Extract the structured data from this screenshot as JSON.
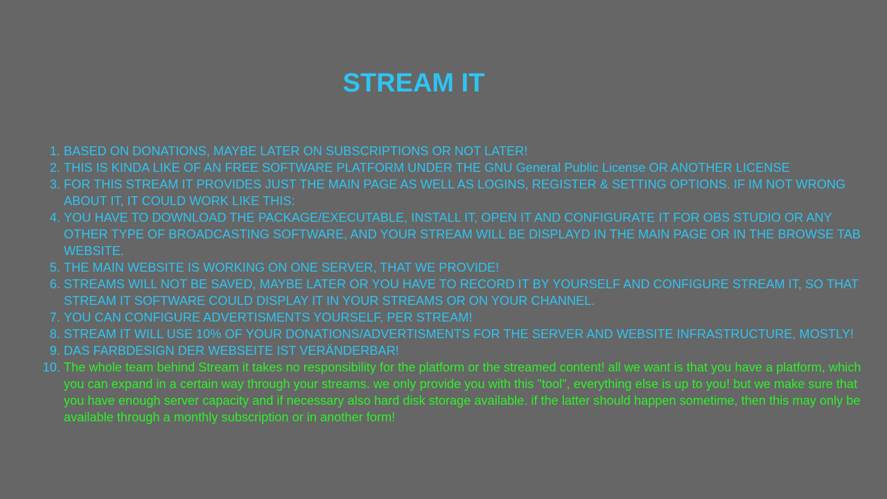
{
  "page": {
    "title": "STREAM IT",
    "colors": {
      "background": "#666666",
      "accent": "#2ec4f2",
      "highlight": "#2ef029"
    }
  },
  "list": {
    "items": [
      "BASED ON DONATIONS, MAYBE LATER ON SUBSCRIPTIONS OR NOT LATER!",
      "THIS IS KINDA LIKE OF AN FREE SOFTWARE PLATFORM UNDER THE GNU General Public License OR ANOTHER LICENSE",
      "FOR THIS STREAM IT PROVIDES JUST THE MAIN PAGE AS WELL AS LOGINS, REGISTER & SETTING OPTIONS. IF IM NOT WRONG ABOUT IT, IT COULD WORK LIKE THIS:",
      "YOU HAVE TO DOWNLOAD THE PACKAGE/EXECUTABLE, INSTALL IT, OPEN IT AND CONFIGURATE IT FOR OBS STUDIO OR ANY OTHER TYPE OF BROADCASTING SOFTWARE, AND YOUR STREAM WILL BE DISPLAYD IN THE MAIN PAGE OR IN THE BROWSE TAB WEBSITE.",
      "THE MAIN WEBSITE IS WORKING ON ONE SERVER, THAT WE PROVIDE!",
      "STREAMS WILL NOT BE SAVED, MAYBE LATER OR YOU HAVE TO RECORD IT BY YOURSELF AND CONFIGURE STREAM IT, SO THAT STREAM IT SOFTWARE COULD DISPLAY IT IN YOUR STREAMS OR ON YOUR CHANNEL.",
      "YOU CAN CONFIGURE ADVERTISMENTS YOURSELF, PER STREAM!",
      "STREAM IT WILL USE 10% OF YOUR DONATIONS/ADVERTISMENTS FOR THE SERVER AND WEBSITE INFRASTRUCTURE, MOSTLY!",
      "DAS FARBDESIGN DER WEBSEITE IST VERÄNDERBAR!",
      "The whole team behind Stream it takes no responsibility for the platform or the streamed content! all we want is that you have a platform, which you can expand in a certain way through your streams. we only provide you with this \"tool\", everything else is up to you! but we make sure that you have enough server capacity and if necessary also hard disk storage available. if the latter should happen sometime, then this may only be available through a monthly subscription or in another form!"
    ]
  }
}
